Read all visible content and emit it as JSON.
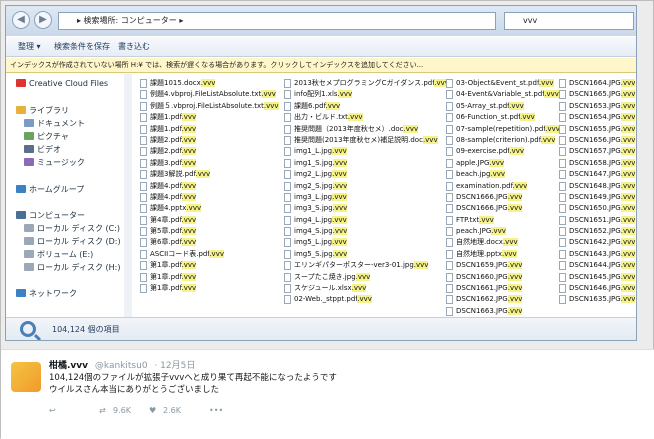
{
  "window": {
    "address_path": "▸ 検索場所: コンピューター ▸",
    "search_value": "vvv",
    "toolbar": {
      "organize": "整理 ▾",
      "save_search": "検索条件を保存",
      "burn": "書き込む"
    },
    "infobar": "インデックスが作成されていない場所 H:¥ では、検索が遅くなる場合があります。クリックしてインデックスを追加してください...",
    "nav": {
      "creative_cloud": "Creative Cloud Files",
      "libraries": "ライブラリ",
      "documents": "ドキュメント",
      "pictures": "ピクチャ",
      "videos": "ビデオ",
      "music": "ミュージック",
      "homegroup": "ホームグループ",
      "computer": "コンピューター",
      "drive_c": "ローカル ディスク (C:)",
      "drive_d": "ローカル ディスク (D:)",
      "drive_e": "ボリューム (E:)",
      "drive_h": "ローカル ディスク (H:)",
      "network": "ネットワーク"
    },
    "columns": [
      [
        "課題1015.docx",
        "例題4.vbproj.FileListAbsolute.txt",
        "例題５.vbproj.FileListAbsolute.txt",
        "課題1.pdf",
        "課題1.pdf",
        "課題2.pdf",
        "課題2.pdf",
        "課題3.pdf",
        "課題3解説.pdf",
        "課題4.pdf",
        "課題4.pdf",
        "課題4.pptx",
        "第4章.pdf",
        "第5章.pdf",
        "第6章.pdf",
        "ASCIIコード表.pdf",
        "第1章.pdf",
        "第1章.pdf",
        "第1章.pdf"
      ],
      [
        "2013秋セメプログラミングCガイダンス.pdf",
        "info配列1.xls",
        "課題6.pdf",
        "出力・ビルド.txt",
        "推奨問題（2013年度秋セメ）.doc",
        "推奨問題(2013年度秋セメ)補足説明.doc",
        "img1_L.jpg",
        "img1_S.jpg",
        "img2_L.jpg",
        "img2_S.jpg",
        "img3_L.jpg",
        "img3_S.jpg",
        "img4_L.jpg",
        "img4_S.jpg",
        "img5_L.jpg",
        "img5_S.jpg",
        "エリンギパターポスター-ver3-01.jpg",
        "スープたこ焼き.jpg",
        "スケジュール.xlsx",
        "02-Web._stppt.pdf"
      ],
      [
        "03-Object&Event_st.pdf",
        "04-Event&Variable_st.pdf",
        "05-Array_st.pdf",
        "06-Function_st.pdf",
        "07-sample(repetition).pdf",
        "08-sample(criterion).pdf",
        "09-exercise.pdf",
        "apple.JPG",
        "beach.jpg",
        "examination.pdf",
        "DSCN1666.JPG",
        "DSCN1666.JPG",
        "FTP.txt",
        "peach.JPG",
        "自然地理.docx",
        "自然地理.pptx",
        "DSCN1659.JPG",
        "DSCN1660.JPG",
        "DSCN1661.JPG",
        "DSCN1662.JPG",
        "DSCN1663.JPG"
      ],
      [
        "DSCN1664.JPG",
        "DSCN1665.JPG",
        "DSCN1653.JPG",
        "DSCN1654.JPG",
        "DSCN1655.JPG",
        "DSCN1656.JPG",
        "DSCN1657.JPG",
        "DSCN1658.JPG",
        "DSCN1647.JPG",
        "DSCN1648.JPG",
        "DSCN1649.JPG",
        "DSCN1650.JPG",
        "DSCN1651.JPG",
        "DSCN1652.JPG",
        "DSCN1642.JPG",
        "DSCN1643.JPG",
        "DSCN1644.JPG",
        "DSCN1645.JPG",
        "DSCN1646.JPG",
        "DSCN1635.JPG"
      ]
    ],
    "highlight_ext": "vvv",
    "status_count": "104,124 個の項目"
  },
  "tweet": {
    "name": "柑橘.vvv",
    "handle": "@kankitsu0",
    "date": "· 12月5日",
    "line1": "104,124個のファイルが拡張子vvvへと成り果て再起不能になったようです",
    "line2": "ウイルスさん本当にありがとうございました",
    "retweets": "9.6K",
    "likes": "2.6K"
  },
  "colors": {
    "highlight": "#f6f28a",
    "window_border": "#8aa1b7",
    "toolbar_text": "#1e395b"
  }
}
